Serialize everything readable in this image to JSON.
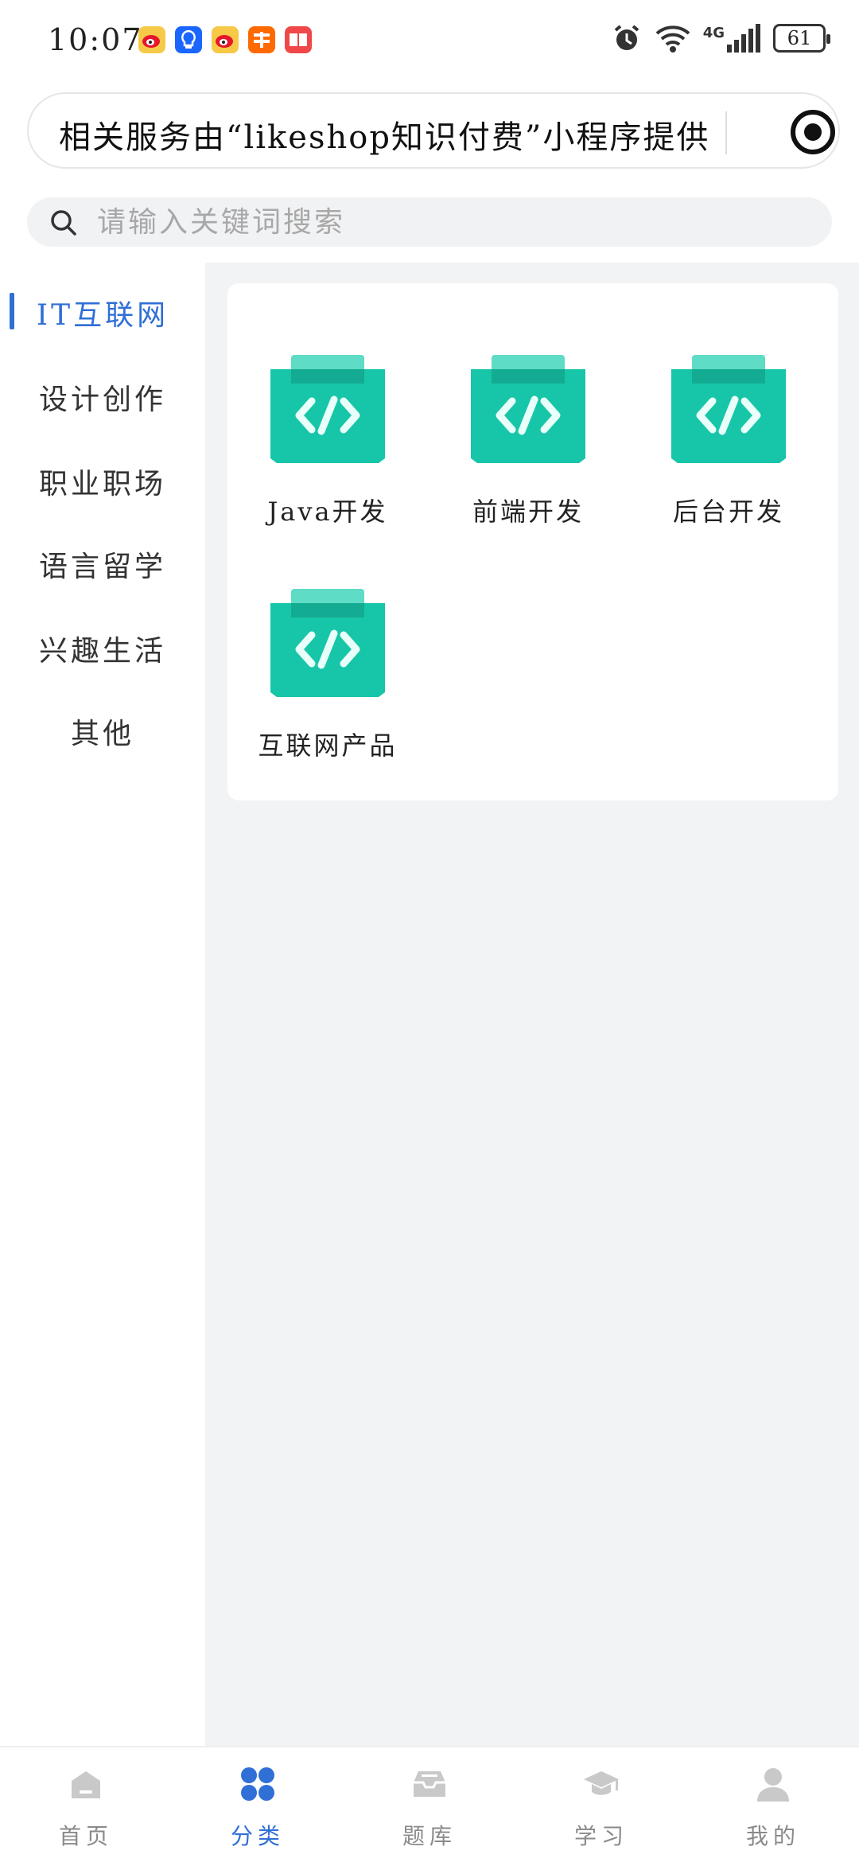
{
  "status_bar": {
    "time": "10:07",
    "battery": "61",
    "network_label": "4G"
  },
  "notice": {
    "text": "相关服务由“likeshop知识付费”小程序提供"
  },
  "search": {
    "placeholder": "请输入关键词搜索"
  },
  "categories": [
    {
      "label": "IT互联网",
      "active": true
    },
    {
      "label": "设计创作",
      "active": false
    },
    {
      "label": "职业职场",
      "active": false
    },
    {
      "label": "语言留学",
      "active": false
    },
    {
      "label": "兴趣生活",
      "active": false
    },
    {
      "label": "其他",
      "active": false
    }
  ],
  "subcategories": [
    {
      "label": "Java开发",
      "icon": "code-folder-icon"
    },
    {
      "label": "前端开发",
      "icon": "code-folder-icon"
    },
    {
      "label": "后台开发",
      "icon": "code-folder-icon"
    },
    {
      "label": "互联网产品",
      "icon": "code-folder-icon"
    }
  ],
  "tabbar": [
    {
      "label": "首页",
      "icon": "home-icon",
      "active": false
    },
    {
      "label": "分类",
      "icon": "category-icon",
      "active": true
    },
    {
      "label": "题库",
      "icon": "question-bank-icon",
      "active": false
    },
    {
      "label": "学习",
      "icon": "graduation-cap-icon",
      "active": false
    },
    {
      "label": "我的",
      "icon": "user-icon",
      "active": false
    }
  ],
  "colors": {
    "accent": "#2f6fd6",
    "icon_teal": "#19c7a8",
    "panel_bg": "#f2f3f5",
    "tab_inactive": "#c9c9c9"
  }
}
